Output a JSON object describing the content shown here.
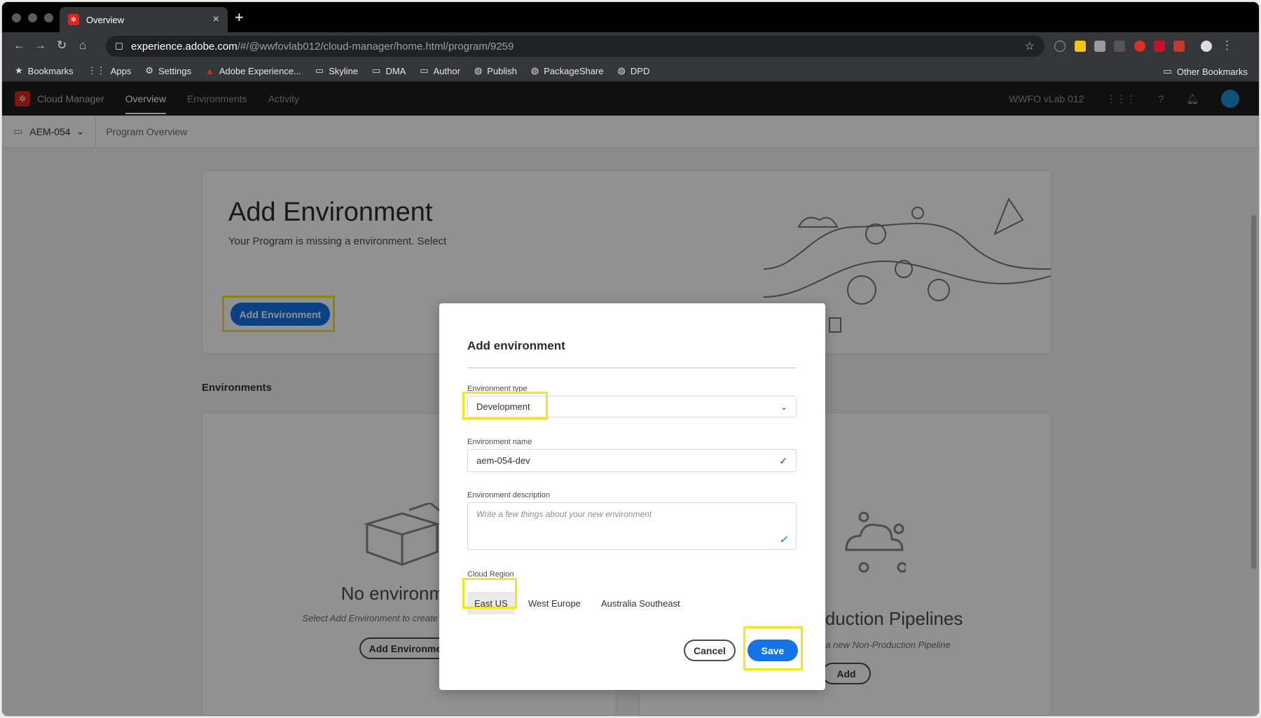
{
  "browser": {
    "tab_title": "Overview",
    "tab_close": "×",
    "new_tab": "+",
    "url_host": "experience.adobe.com",
    "url_path": "/#/@wwfovlab012/cloud-manager/home.html/program/9259",
    "bookmarks": [
      {
        "label": "Bookmarks",
        "icon": "star-icon"
      },
      {
        "label": "Apps",
        "icon": "apps-grid-icon"
      },
      {
        "label": "Settings",
        "icon": "gear-icon"
      },
      {
        "label": "Adobe Experience...",
        "icon": "adobe-icon"
      },
      {
        "label": "Skyline",
        "icon": "folder-icon"
      },
      {
        "label": "DMA",
        "icon": "folder-icon"
      },
      {
        "label": "Author",
        "icon": "folder-icon"
      },
      {
        "label": "Publish",
        "icon": "globe-icon"
      },
      {
        "label": "PackageShare",
        "icon": "globe-icon"
      },
      {
        "label": "DPD",
        "icon": "globe-icon"
      }
    ],
    "other_bookmarks": "Other Bookmarks"
  },
  "app": {
    "name": "Cloud Manager",
    "nav": [
      "Overview",
      "Environments",
      "Activity"
    ],
    "org": "WWFO vLab 012",
    "program": "AEM-054",
    "breadcrumb": "Program Overview"
  },
  "page": {
    "add_env_title": "Add Environment",
    "add_env_sub": "Your Program is missing a environment. Select",
    "add_env_button": "Add Environment",
    "environments_heading": "Environments",
    "no_env_title": "No environments",
    "no_env_sub": "Select Add Environment to create a new environment",
    "no_env_button": "Add Environment",
    "no_pipe_title": "No Non-Production Pipelines",
    "no_pipe_sub": "Select Add to create a new Non-Production Pipeline",
    "no_pipe_button": "Add"
  },
  "modal": {
    "title": "Add environment",
    "env_type_label": "Environment type",
    "env_type_value": "Development",
    "env_name_label": "Environment name",
    "env_name_value": "aem-054-dev",
    "env_desc_label": "Environment description",
    "env_desc_placeholder": "Write a few things about your new environment",
    "region_label": "Cloud Region",
    "regions": [
      "East US",
      "West Europe",
      "Australia Southeast"
    ],
    "selected_region": "East US",
    "cancel": "Cancel",
    "save": "Save"
  },
  "colors": {
    "accent": "#1473e6",
    "highlight": "#f5e51b",
    "brand": "#e0251b"
  }
}
